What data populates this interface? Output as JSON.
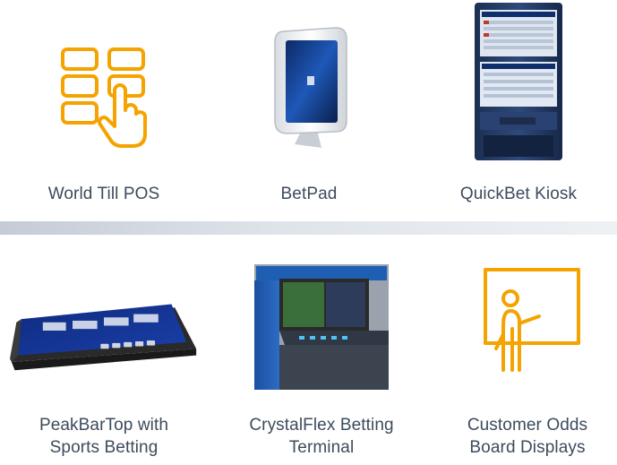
{
  "colors": {
    "icon_accent": "#f4a300",
    "caption_text": "#3d4b5d",
    "divider": "#d3d9e0"
  },
  "top_row": [
    {
      "label": "World Till POS",
      "icon": "touch-grid-icon"
    },
    {
      "label": "BetPad",
      "icon": "tablet-stand-image"
    },
    {
      "label": "QuickBet Kiosk",
      "icon": "kiosk-image"
    }
  ],
  "bottom_row": [
    {
      "label": "PeakBarTop with\nSports Betting",
      "icon": "bartop-terminal-image"
    },
    {
      "label": "CrystalFlex Betting\nTerminal",
      "icon": "betting-terminal-image"
    },
    {
      "label": "Customer Odds\nBoard Displays",
      "icon": "presenter-board-icon"
    }
  ]
}
